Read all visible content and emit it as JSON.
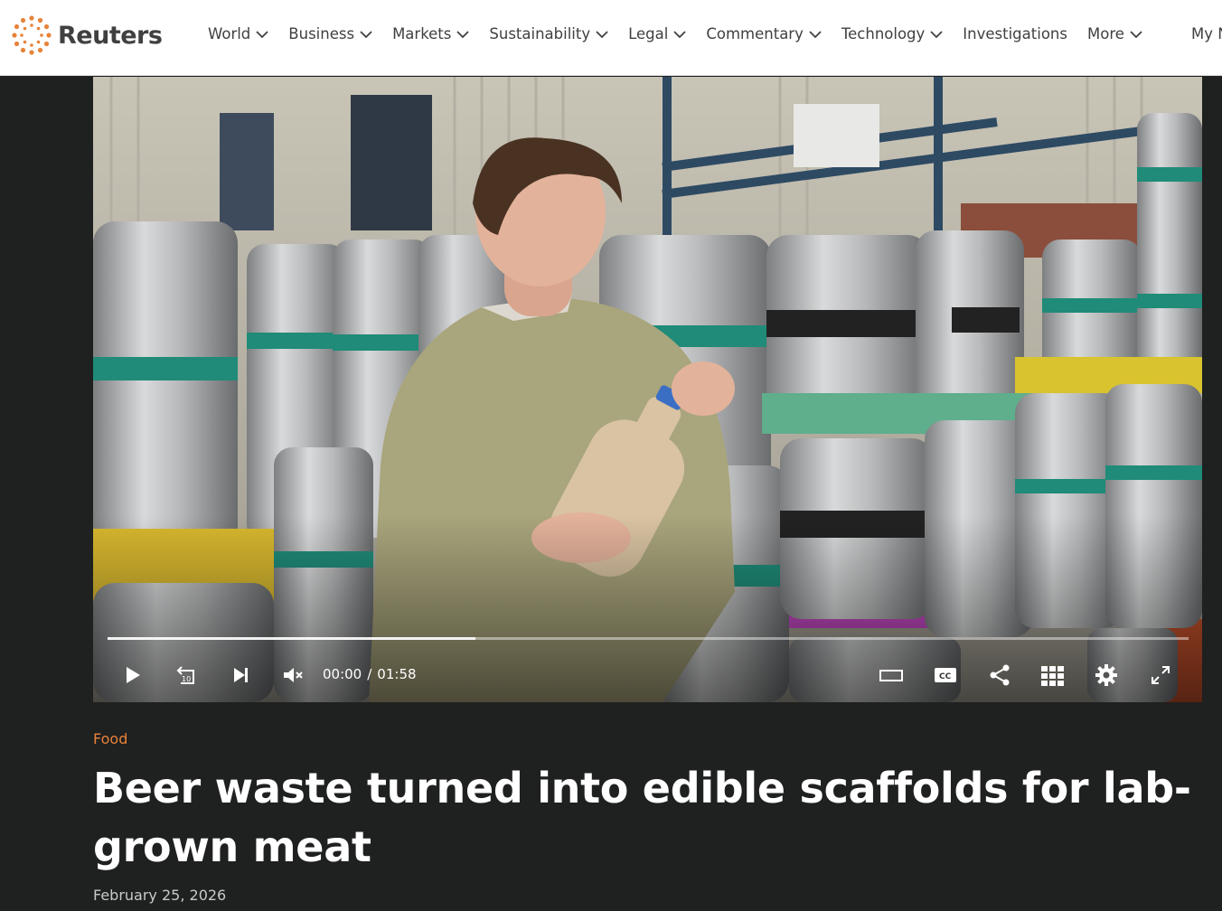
{
  "brand": {
    "name": "Reuters",
    "accent": "#e8833a"
  },
  "nav": {
    "items": [
      {
        "label": "World",
        "has_dropdown": true
      },
      {
        "label": "Business",
        "has_dropdown": true
      },
      {
        "label": "Markets",
        "has_dropdown": true
      },
      {
        "label": "Sustainability",
        "has_dropdown": true
      },
      {
        "label": "Legal",
        "has_dropdown": true
      },
      {
        "label": "Commentary",
        "has_dropdown": true
      },
      {
        "label": "Technology",
        "has_dropdown": true
      },
      {
        "label": "Investigations",
        "has_dropdown": false
      },
      {
        "label": "More",
        "has_dropdown": true
      }
    ],
    "account_label": "My N"
  },
  "video": {
    "current_time": "00:00",
    "separator": "/",
    "duration": "01:58",
    "buffered_fraction": 0.34,
    "controls": [
      "play-icon",
      "replay-10-icon",
      "skip-next-icon",
      "mute-icon",
      "theater-mode-icon",
      "closed-captions-icon",
      "share-icon",
      "grid-icon",
      "settings-icon",
      "fullscreen-icon"
    ],
    "cc_label": "CC",
    "replay_label": "10"
  },
  "article": {
    "category": "Food",
    "headline": "Beer waste turned into edible scaffolds for lab-grown meat",
    "date": "February 25, 2026"
  }
}
